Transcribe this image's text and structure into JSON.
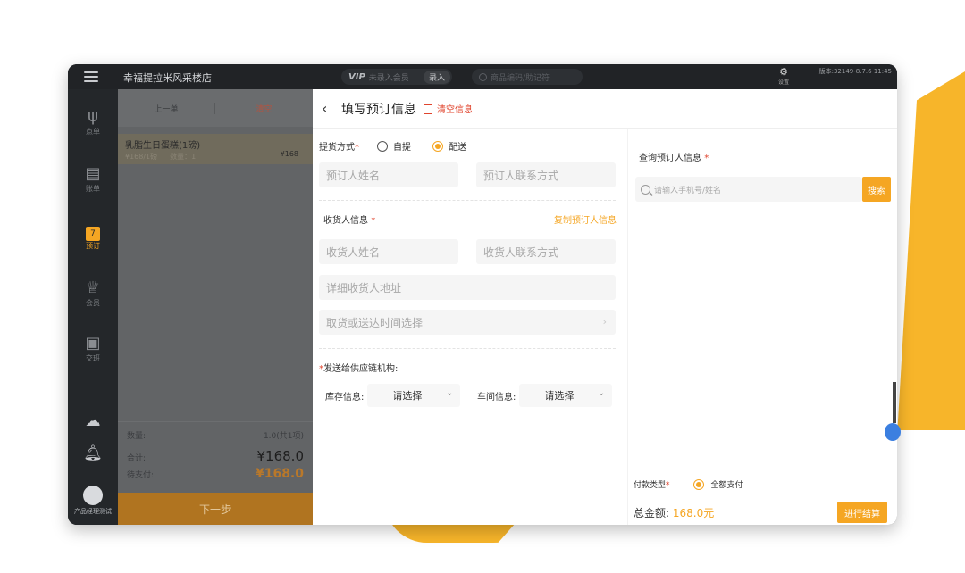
{
  "topbar": {
    "store_name": "幸福提拉米风采楼店",
    "vip_label": "VIP",
    "vip_placeholder": "未录入会员",
    "enter_label": "录入",
    "search_placeholder": "商品编码/助记符",
    "settings_label": "设置",
    "version": "版本:32149-8.7.6 11:45"
  },
  "leftnav": {
    "items": [
      {
        "label": "点单",
        "icon": "utensils-icon"
      },
      {
        "label": "账单",
        "icon": "clipboard-icon"
      },
      {
        "label": "预订",
        "icon": "calendar-icon",
        "badge": "7"
      },
      {
        "label": "会员",
        "icon": "crown-icon"
      },
      {
        "label": "交班",
        "icon": "cashbox-icon"
      }
    ],
    "user_label": "产品经理测试"
  },
  "cart": {
    "prev_label": "上一单",
    "clear_label": "清空",
    "item": {
      "name": "乳脂生日蛋糕(1磅)",
      "unit_price": "¥168/1磅",
      "qty": "数量：1",
      "price": "¥168"
    },
    "qty_label": "数量:",
    "qty_value": "1.0(共1项)",
    "total_label": "合计:",
    "total_value": "¥168.0",
    "due_label": "待支付:",
    "due_value": "¥168.0",
    "next_label": "下一步"
  },
  "form": {
    "title": "填写预订信息",
    "clear_info": "清空信息",
    "pickup_method_label": "提货方式",
    "required_mark": "*",
    "opt_self": "自提",
    "opt_delivery": "配送",
    "booker_name_ph": "预订人姓名",
    "booker_contact_ph": "预订人联系方式",
    "receiver_label": "收货人信息",
    "copy_booker": "复制预订人信息",
    "receiver_name_ph": "收货人姓名",
    "receiver_contact_ph": "收货人联系方式",
    "address_ph": "详细收货人地址",
    "time_ph": "取货或送达时间选择",
    "supply_label": "发送给供应链机构:",
    "stock_label": "库存信息:",
    "workshop_label": "车间信息:",
    "select_placeholder": "请选择"
  },
  "right": {
    "query_label": "查询预订人信息",
    "query_ph": "请输入手机号/姓名",
    "search_label": "搜索",
    "pay_type_label": "付款类型",
    "pay_full": "全额支付",
    "total_label": "总金额:",
    "total_value": "168.0元",
    "checkout_label": "进行结算"
  },
  "colors": {
    "accent": "#f5a623",
    "danger": "#e0442d",
    "dark": "#1d1f22"
  }
}
